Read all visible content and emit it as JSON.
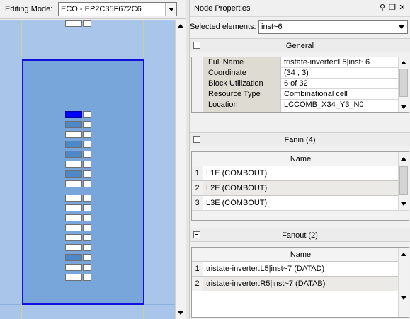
{
  "editing_mode": {
    "label": "Editing Mode:",
    "value": "ECO - EP2C35F672C6"
  },
  "floorplan": {
    "colors": {
      "background": "#a9c6ea",
      "lab": "#78a6da",
      "lab_border": "#1111dd",
      "used_cell": "#4d89c9",
      "selected_cell": "#0000ff"
    }
  },
  "node_properties": {
    "title": "Node Properties",
    "selected_label": "Selected elements:",
    "selected_value": "inst~6",
    "general": {
      "title": "General",
      "rows": [
        {
          "key": "Full Name",
          "value": "tristate-inverter:L5|inst~6"
        },
        {
          "key": "Coordinate",
          "value": "(34 , 3)"
        },
        {
          "key": "Block Utilization",
          "value": "6 of 32"
        },
        {
          "key": "Resource Type",
          "value": "Combinational cell"
        },
        {
          "key": "Location",
          "value": "LCCOMB_X34_Y3_N0"
        },
        {
          "key": "Location Assignment",
          "value": "N"
        }
      ]
    },
    "fanin": {
      "title": "Fanin (4)",
      "column": "Name",
      "rows": [
        {
          "num": "1",
          "name": "L1E (COMBOUT)"
        },
        {
          "num": "2",
          "name": "L2E (COMBOUT)"
        },
        {
          "num": "3",
          "name": "L3E (COMBOUT)"
        }
      ]
    },
    "fanout": {
      "title": "Fanout (2)",
      "column": "Name",
      "rows": [
        {
          "num": "1",
          "name": "tristate-inverter:L5|inst~7 (DATAD)"
        },
        {
          "num": "2",
          "name": "tristate-inverter:R5|inst~7 (DATAB)"
        }
      ]
    }
  }
}
